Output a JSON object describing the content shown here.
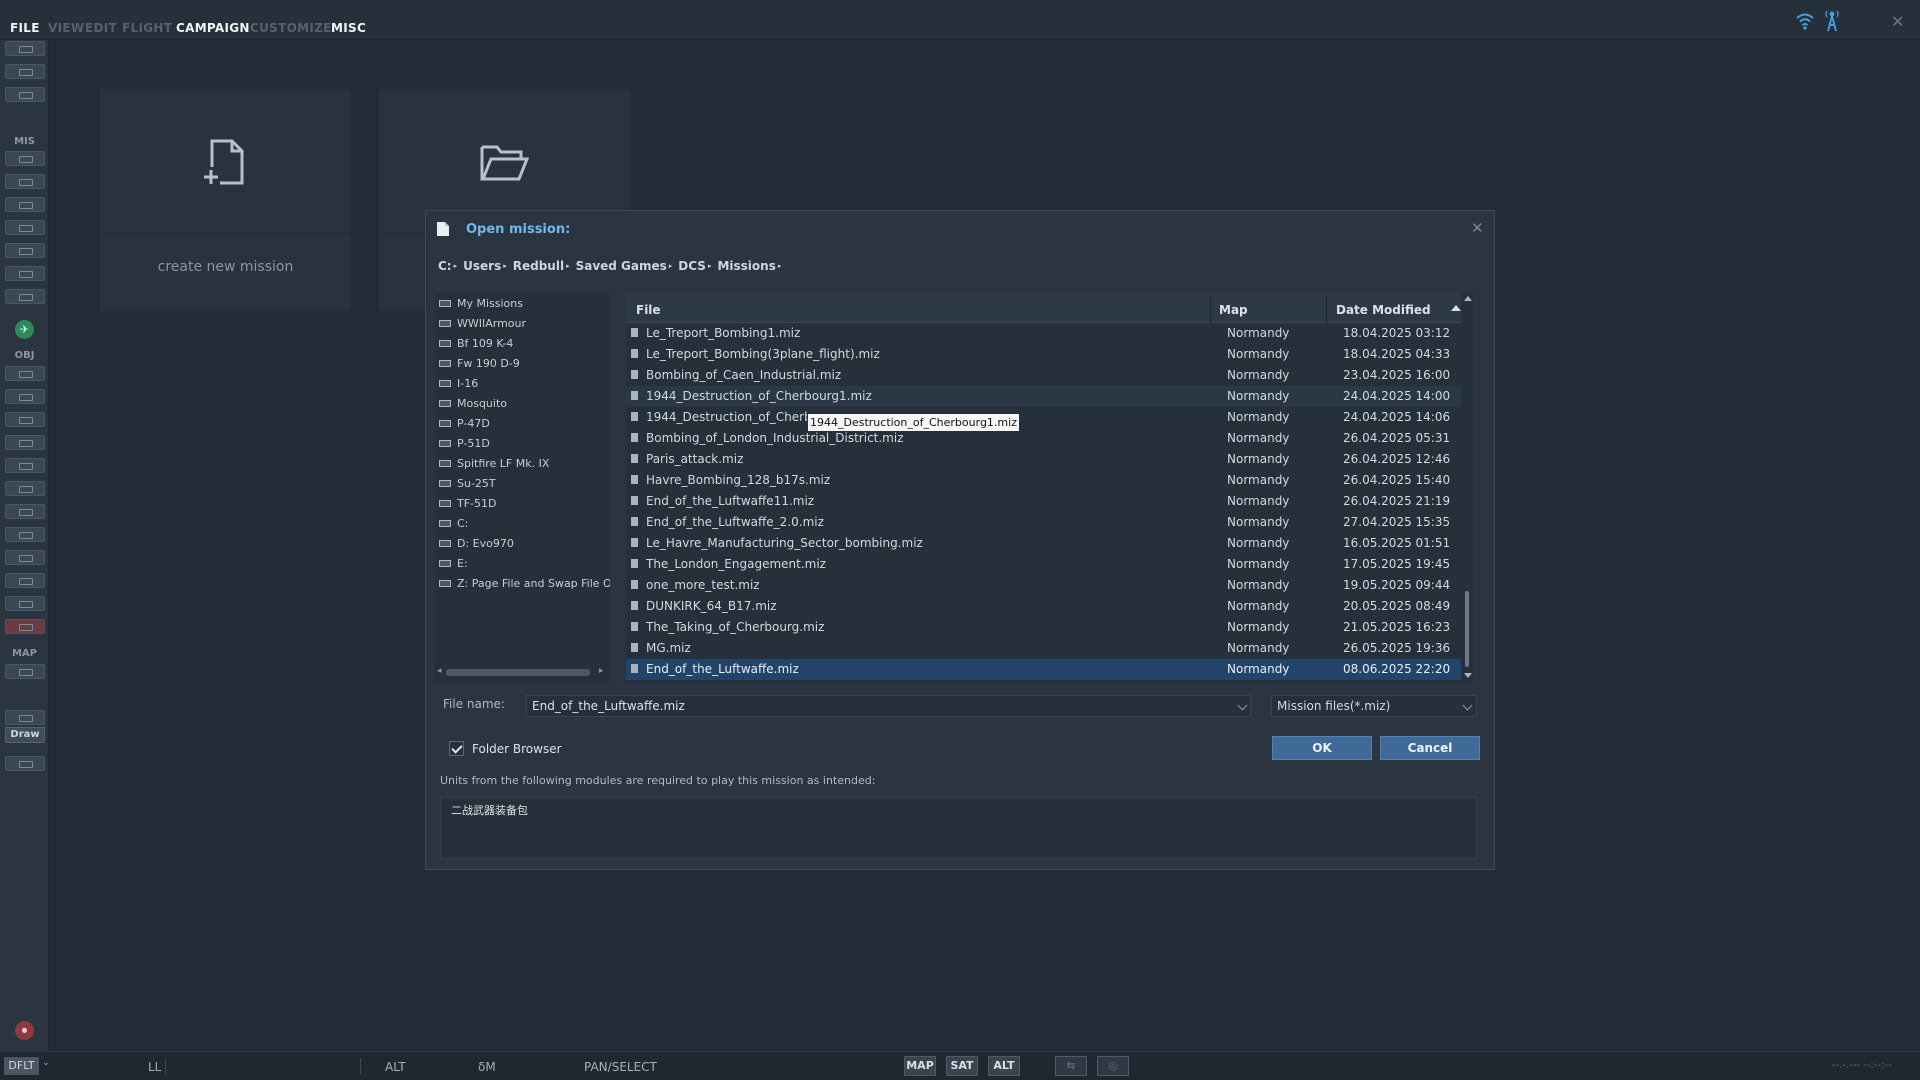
{
  "menubar": {
    "items": [
      {
        "label": "FILE",
        "enabled": true
      },
      {
        "label": "VIEW",
        "enabled": false
      },
      {
        "label": "EDIT",
        "enabled": false
      },
      {
        "label": "FLIGHT",
        "enabled": false
      },
      {
        "label": "CAMPAIGN",
        "enabled": true
      },
      {
        "label": "CUSTOMIZE",
        "enabled": false
      },
      {
        "label": "MISC",
        "enabled": true
      }
    ]
  },
  "toolbar": {
    "sections": {
      "mis": "MIS",
      "obj": "OBJ",
      "map": "MAP"
    },
    "draw_label": "Draw"
  },
  "start_cards": {
    "create_label": "create new mission"
  },
  "dialog": {
    "title": "Open mission:",
    "breadcrumb": [
      "C:",
      "Users",
      "Redbull",
      "Saved Games",
      "DCS",
      "Missions"
    ],
    "folders": [
      "My Missions",
      "WWIIArmour",
      "Bf 109 K-4",
      "Fw 190 D-9",
      "I-16",
      "Mosquito",
      "P-47D",
      "P-51D",
      "Spitfire LF Mk. IX",
      "Su-25T",
      "TF-51D",
      "C:",
      "D: Evo970",
      "E:",
      "Z: Page File and Swap File ONLY"
    ],
    "columns": {
      "file": "File",
      "map": "Map",
      "date": "Date Modified"
    },
    "files": [
      {
        "name": "Le_Treport_Bombing1.miz",
        "map": "Normandy",
        "date": "18.04.2025 03:12"
      },
      {
        "name": "Le_Treport_Bombing(3plane_flight).miz",
        "map": "Normandy",
        "date": "18.04.2025 04:33"
      },
      {
        "name": "Bombing_of_Caen_Industrial.miz",
        "map": "Normandy",
        "date": "23.04.2025 16:00"
      },
      {
        "name": "1944_Destruction_of_Cherbourg1.miz",
        "map": "Normandy",
        "date": "24.04.2025 14:00"
      },
      {
        "name": "1944_Destruction_of_Cherb",
        "map": "Normandy",
        "date": "24.04.2025 14:06"
      },
      {
        "name": "Bombing_of_London_Industrial_District.miz",
        "map": "Normandy",
        "date": "26.04.2025 05:31"
      },
      {
        "name": "Paris_attack.miz",
        "map": "Normandy",
        "date": "26.04.2025 12:46"
      },
      {
        "name": "Havre_Bombing_128_b17s.miz",
        "map": "Normandy",
        "date": "26.04.2025 15:40"
      },
      {
        "name": "End_of_the_Luftwaffe11.miz",
        "map": "Normandy",
        "date": "26.04.2025 21:19"
      },
      {
        "name": "End_of_the_Luftwaffe_2.0.miz",
        "map": "Normandy",
        "date": "27.04.2025 15:35"
      },
      {
        "name": "Le_Havre_Manufacturing_Sector_bombing.miz",
        "map": "Normandy",
        "date": "16.05.2025 01:51"
      },
      {
        "name": "The_London_Engagement.miz",
        "map": "Normandy",
        "date": "17.05.2025 19:45"
      },
      {
        "name": "one_more_test.miz",
        "map": "Normandy",
        "date": "19.05.2025 09:44"
      },
      {
        "name": "DUNKIRK_64_B17.miz",
        "map": "Normandy",
        "date": "20.05.2025 08:49"
      },
      {
        "name": "The_Taking_of_Cherbourg.miz",
        "map": "Normandy",
        "date": "21.05.2025 16:23"
      },
      {
        "name": "MG.miz",
        "map": "Normandy",
        "date": "26.05.2025 19:36"
      },
      {
        "name": "End_of_the_Luftwaffe.miz",
        "map": "Normandy",
        "date": "08.06.2025 22:20",
        "selected": true
      }
    ],
    "tooltip": "1944_Destruction_of_Cherbourg1.miz",
    "file_name_label": "File name:",
    "file_name_value": "End_of_the_Luftwaffe.miz",
    "file_type": "Mission files(*.miz)",
    "folder_browser_label": "Folder Browser",
    "folder_browser_checked": true,
    "ok_label": "OK",
    "cancel_label": "Cancel",
    "units_label": "Units from the following modules are required to play this mission as intended:",
    "units_value": "二战武器装备包"
  },
  "statusbar": {
    "mode": "DFLT",
    "coord_format": "LL",
    "alt": "ALT",
    "delta": "δM",
    "action": "PAN/SELECT",
    "map_btn": "MAP",
    "sat_btn": "SAT",
    "alt_btn": "ALT",
    "coords": "--.-.--- --:--:--"
  },
  "colors": {
    "accent": "#6fb9ec",
    "selection": "#23446a",
    "button": "#3f6a98"
  }
}
